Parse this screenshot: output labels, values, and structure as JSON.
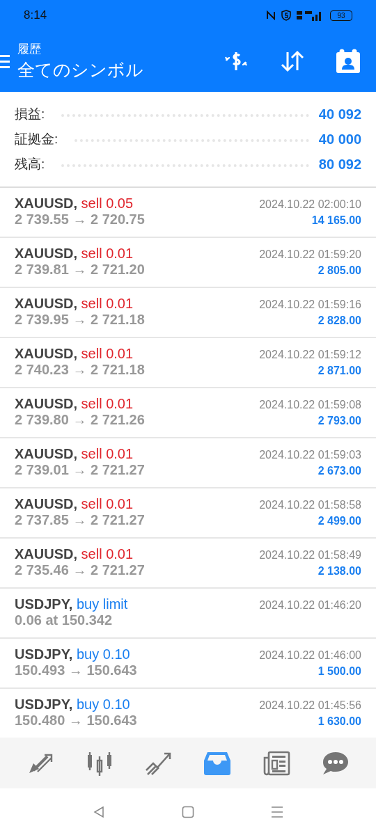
{
  "status_bar": {
    "time": "8:14",
    "battery": "93"
  },
  "header": {
    "subtitle": "履歴",
    "title": "全てのシンボル"
  },
  "summary": [
    {
      "label": "損益:",
      "value": "40 092"
    },
    {
      "label": "証拠金:",
      "value": "40 000"
    },
    {
      "label": "残高:",
      "value": "80 092"
    }
  ],
  "deals": [
    {
      "symbol": "XAUUSD,",
      "kind": "sell",
      "action": "sell 0.05",
      "prices": "2 739.55 → 2 720.75",
      "time": "2024.10.22 02:00:10",
      "profit": "14 165.00"
    },
    {
      "symbol": "XAUUSD,",
      "kind": "sell",
      "action": "sell 0.01",
      "prices": "2 739.81 → 2 721.20",
      "time": "2024.10.22 01:59:20",
      "profit": "2 805.00"
    },
    {
      "symbol": "XAUUSD,",
      "kind": "sell",
      "action": "sell 0.01",
      "prices": "2 739.95 → 2 721.18",
      "time": "2024.10.22 01:59:16",
      "profit": "2 828.00"
    },
    {
      "symbol": "XAUUSD,",
      "kind": "sell",
      "action": "sell 0.01",
      "prices": "2 740.23 → 2 721.18",
      "time": "2024.10.22 01:59:12",
      "profit": "2 871.00"
    },
    {
      "symbol": "XAUUSD,",
      "kind": "sell",
      "action": "sell 0.01",
      "prices": "2 739.80 → 2 721.26",
      "time": "2024.10.22 01:59:08",
      "profit": "2 793.00"
    },
    {
      "symbol": "XAUUSD,",
      "kind": "sell",
      "action": "sell 0.01",
      "prices": "2 739.01 → 2 721.27",
      "time": "2024.10.22 01:59:03",
      "profit": "2 673.00"
    },
    {
      "symbol": "XAUUSD,",
      "kind": "sell",
      "action": "sell 0.01",
      "prices": "2 737.85 → 2 721.27",
      "time": "2024.10.22 01:58:58",
      "profit": "2 499.00"
    },
    {
      "symbol": "XAUUSD,",
      "kind": "sell",
      "action": "sell 0.01",
      "prices": "2 735.46 → 2 721.27",
      "time": "2024.10.22 01:58:49",
      "profit": "2 138.00"
    },
    {
      "symbol": "USDJPY,",
      "kind": "buy",
      "action": "buy limit",
      "prices": "0.06 at 150.342",
      "time": "2024.10.22 01:46:20"
    },
    {
      "symbol": "USDJPY,",
      "kind": "buy",
      "action": "buy 0.10",
      "prices": "150.493 → 150.643",
      "time": "2024.10.22 01:46:00",
      "profit": "1 500.00"
    },
    {
      "symbol": "USDJPY,",
      "kind": "buy",
      "action": "buy 0.10",
      "prices": "150.480 → 150.643",
      "time": "2024.10.22 01:45:56",
      "profit": "1 630.00"
    }
  ],
  "bottom_nav": [
    {
      "kind": "quotes",
      "selected": false
    },
    {
      "kind": "chart",
      "selected": false
    },
    {
      "kind": "trade",
      "selected": false
    },
    {
      "kind": "history",
      "selected": true
    },
    {
      "kind": "news",
      "selected": false
    },
    {
      "kind": "chat",
      "selected": false
    }
  ]
}
